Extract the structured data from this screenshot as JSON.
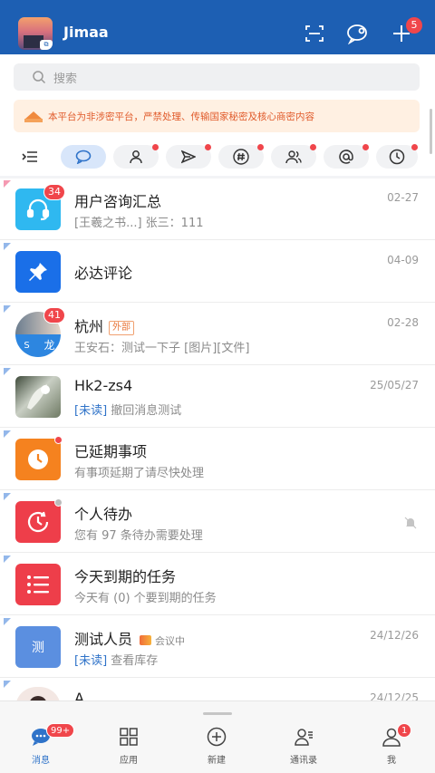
{
  "header": {
    "title": "Jimaa",
    "plus_badge": "5"
  },
  "search": {
    "placeholder": "搜索"
  },
  "notice": {
    "text": "本平台为非涉密平台，严禁处理、传输国家秘密及核心商密内容"
  },
  "chats": [
    {
      "title": "用户咨询汇总",
      "sub": "[王羲之书...] 张三：111",
      "time": "02-27",
      "badge": "34",
      "avatar_color": "#2fb8f0",
      "icon": "headset-icon"
    },
    {
      "title": "必达评论",
      "sub": "",
      "time": "04-09",
      "avatar_color": "#1a6fe8",
      "icon": "pin-icon"
    },
    {
      "title": "杭州",
      "tag": "外部",
      "sub": "王安石：测试一下子 [图片][文件]",
      "time": "02-28",
      "badge": "41",
      "avatar_initials": [
        "S",
        "龙"
      ]
    },
    {
      "title": "Hk2-zs4",
      "unread": "[未读]",
      "sub": "撤回消息测试",
      "time": "25/05/27"
    },
    {
      "title": "已延期事项",
      "sub": "有事项延期了请尽快处理",
      "time": "",
      "avatar_color": "#f5821f",
      "icon": "clock-icon"
    },
    {
      "title": "个人待办",
      "sub": "您有 97 条待办需要处理",
      "time": "",
      "avatar_color": "#ee3e4a",
      "icon": "todo-clock-icon"
    },
    {
      "title": "今天到期的任务",
      "sub": "今天有 (0) 个要到期的任务",
      "time": "",
      "avatar_color": "#ee3e4a",
      "icon": "list-icon"
    },
    {
      "title": "测试人员",
      "meeting": "会议中",
      "unread": "[未读]",
      "sub": "查看库存",
      "time": "24/12/26",
      "avatar_color": "#5b8fe0",
      "avatar_text": "测"
    },
    {
      "title": "A",
      "sub": "",
      "time": "24/12/25"
    }
  ],
  "tabs": [
    {
      "label": "消息",
      "badge": "99+"
    },
    {
      "label": "应用"
    },
    {
      "label": "新建"
    },
    {
      "label": "通讯录"
    },
    {
      "label": "我",
      "badge": "1"
    }
  ],
  "colors": {
    "brand": "#1d5fb3",
    "badge": "#f0464b",
    "active": "#2f73c9"
  }
}
